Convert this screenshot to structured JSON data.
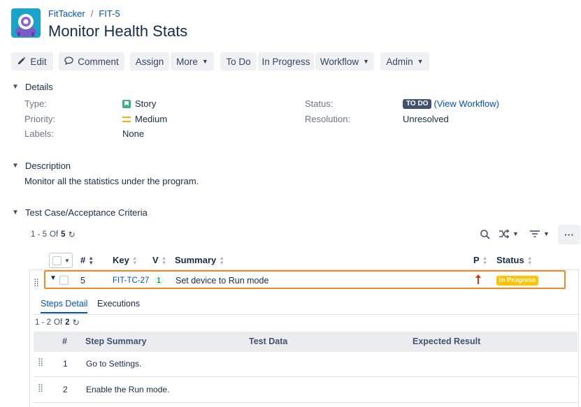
{
  "breadcrumb": {
    "project": "FitTacker",
    "issue_key": "FIT-5"
  },
  "title": "Monitor Health Stats",
  "toolbar": {
    "edit": "Edit",
    "comment": "Comment",
    "assign": "Assign",
    "more": "More",
    "todo": "To Do",
    "in_progress": "In Progress",
    "workflow": "Workflow",
    "admin": "Admin"
  },
  "details": {
    "heading": "Details",
    "type_label": "Type:",
    "type_value": "Story",
    "priority_label": "Priority:",
    "priority_value": "Medium",
    "labels_label": "Labels:",
    "labels_value": "None",
    "status_label": "Status:",
    "status_value": "TO DO",
    "view_workflow": "(View Workflow)",
    "resolution_label": "Resolution:",
    "resolution_value": "Unresolved"
  },
  "description": {
    "heading": "Description",
    "text": "Monitor all the statistics under the program."
  },
  "test_cases": {
    "heading": "Test Case/Acceptance Criteria",
    "pager_range": "1 - 5",
    "pager_of": "Of",
    "pager_total": "5",
    "columns": {
      "num": "#",
      "key": "Key",
      "version": "V",
      "summary": "Summary",
      "priority": "P",
      "status": "Status"
    },
    "row": {
      "num": "5",
      "key": "FIT-TC-27",
      "version": "1",
      "summary": "Set device to Run mode",
      "status": "In Progress"
    }
  },
  "steps_panel": {
    "tabs": [
      "Steps Detail",
      "Executions"
    ],
    "pager_range": "1 - 2",
    "pager_of": "Of",
    "pager_total": "2",
    "columns": {
      "num": "#",
      "summary": "Step Summary",
      "data": "Test Data",
      "expected": "Expected Result"
    },
    "rows": [
      {
        "num": "1",
        "summary": "Go to Settings."
      },
      {
        "num": "2",
        "summary": "Enable the Run mode."
      }
    ]
  },
  "colors": {
    "link": "#0052cc",
    "highlight_border": "#f08a24",
    "todo_lozenge": "#42526e",
    "in_progress_lozenge": "#ffc400",
    "priority_arrow": "#de350b",
    "story_green": "#36b37e"
  }
}
